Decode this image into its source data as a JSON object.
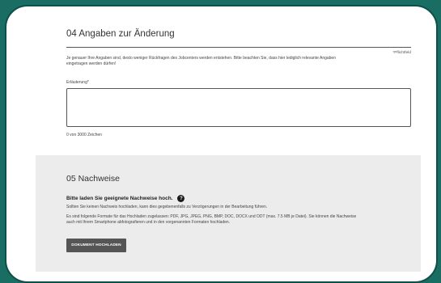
{
  "section_change": {
    "title": "04 Angaben zur Änderung",
    "required_note": "*Pflichtfeld",
    "intro": "Je genauer Ihre Angaben sind, desto weniger Rückfragen des Jobcenters werden entstehen. Bitte beachten Sie, dass hier lediglich relevante Angaben eingetragen werden dürfen!",
    "field_label": "Erläuterung*",
    "field_value": "",
    "char_counter": "0 von 3000 Zeichen"
  },
  "section_proof": {
    "title": "05 Nachweise",
    "subtitle": "Bitte laden Sie geeignete Nachweise hoch.",
    "info_icon_glyph": "?",
    "note": "Sollten Sie keinen Nachweis hochladen, kann dies gegebenenfalls zu Verzögerungen in der Bearbeitung führen.",
    "formats": "Es sind folgende Formate für das Hochladen zugelassen: PDF, JPG, JPEG, PNG, BMP, DOC, DOCX und ODT (max. 7.5 MB je Datei). Sie können die Nachweise auch mit Ihrem Smartphone abfotografieren und in den vorgenannten Formaten hochladen.",
    "upload_button": "DOKUMENT HOCHLADEN"
  },
  "colors": {
    "frame_background": "#196d63",
    "panel_grey": "#ececec",
    "button": "#555555"
  }
}
